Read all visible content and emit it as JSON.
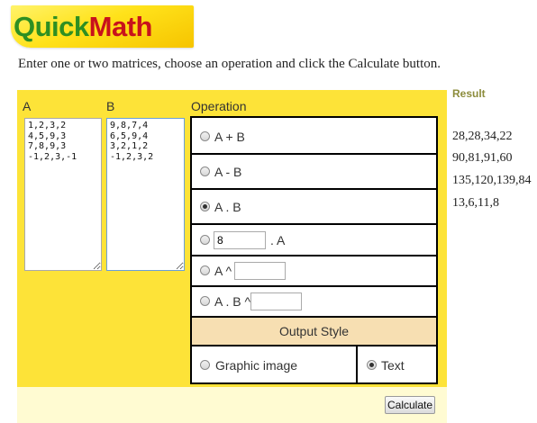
{
  "logo": {
    "quick": "Quick",
    "math": "Math"
  },
  "instructions": "Enter one or two matrices, choose an operation and click the Calculate button.",
  "matrix_a": {
    "label": "A",
    "value": "1,2,3,2\n4,5,9,3\n7,8,9,3\n-1,2,3,-1"
  },
  "matrix_b": {
    "label": "B",
    "value": "9,8,7,4\n6,5,9,4\n3,2,1,2\n-1,2,3,2"
  },
  "operation": {
    "header": "Operation",
    "add_label": "A + B",
    "subtract_label": "A - B",
    "multiply_label": "A . B",
    "selected": "A . B",
    "scalar_value": "8",
    "scalar_suffix": ". A",
    "power_a_label": "A ^",
    "power_ab_label": "A . B ^",
    "output_style_header": "Output Style",
    "graphic_label": "Graphic image",
    "text_label": "Text",
    "selected_output": "Text"
  },
  "calculate_label": "Calculate",
  "result": {
    "title": "Result",
    "rows": [
      "28,28,34,22",
      "90,81,91,60",
      "135,120,139,84",
      "13,6,11,8"
    ]
  },
  "colors": {
    "panel": "#fde338",
    "output_style_bg": "#f7dfb2",
    "result_title": "#8c8c3c"
  }
}
